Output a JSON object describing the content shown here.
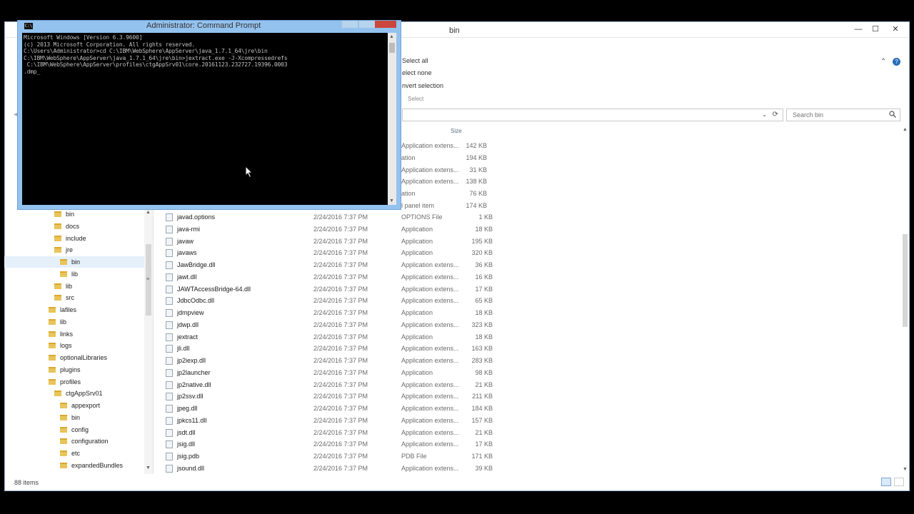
{
  "explorer": {
    "title": "bin",
    "controls": {
      "minimize": "—",
      "maximize": "☐",
      "close": "✕"
    },
    "ribbon": {
      "select_all": "Select all",
      "select_none": "elect none",
      "invert_selection": "nvert selection",
      "group_label": "Select"
    },
    "search_placeholder": "Search bin",
    "columns": {
      "size": "Size"
    },
    "nav_items": [
      {
        "label": "bin",
        "selected": false
      },
      {
        "label": "docs",
        "selected": false
      },
      {
        "label": "include",
        "selected": false
      },
      {
        "label": "jre",
        "selected": false
      },
      {
        "label": "bin",
        "selected": true
      },
      {
        "label": "lib",
        "selected": false
      },
      {
        "label": "lib",
        "selected": false
      },
      {
        "label": "src",
        "selected": false
      },
      {
        "label": "lafiles",
        "selected": false
      },
      {
        "label": "lib",
        "selected": false
      },
      {
        "label": "links",
        "selected": false
      },
      {
        "label": "logs",
        "selected": false
      },
      {
        "label": "optionalLibraries",
        "selected": false
      },
      {
        "label": "plugins",
        "selected": false
      },
      {
        "label": "profiles",
        "selected": false
      },
      {
        "label": "ctgAppSrv01",
        "selected": false
      },
      {
        "label": "appexport",
        "selected": false
      },
      {
        "label": "bin",
        "selected": false
      },
      {
        "label": "config",
        "selected": false
      },
      {
        "label": "configuration",
        "selected": false
      },
      {
        "label": "etc",
        "selected": false
      },
      {
        "label": "expandedBundles",
        "selected": false
      }
    ],
    "partial_rows": [
      {
        "type": "Application extens...",
        "size": "142 KB"
      },
      {
        "type": "ation",
        "size": "194 KB"
      },
      {
        "type": "Application extens...",
        "size": "31 KB"
      },
      {
        "type": "Application extens...",
        "size": "138 KB"
      },
      {
        "type": "ation",
        "size": "76 KB"
      },
      {
        "type": "l panel item",
        "size": "174 KB"
      }
    ],
    "files": [
      {
        "name": "javad.options",
        "date": "2/24/2016 7:37 PM",
        "type": "OPTIONS File",
        "size": "1 KB"
      },
      {
        "name": "java-rmi",
        "date": "2/24/2016 7:37 PM",
        "type": "Application",
        "size": "18 KB"
      },
      {
        "name": "javaw",
        "date": "2/24/2016 7:37 PM",
        "type": "Application",
        "size": "195 KB"
      },
      {
        "name": "javaws",
        "date": "2/24/2016 7:37 PM",
        "type": "Application",
        "size": "320 KB"
      },
      {
        "name": "JawBridge.dll",
        "date": "2/24/2016 7:37 PM",
        "type": "Application extens...",
        "size": "36 KB"
      },
      {
        "name": "jawt.dll",
        "date": "2/24/2016 7:37 PM",
        "type": "Application extens...",
        "size": "16 KB"
      },
      {
        "name": "JAWTAccessBridge-64.dll",
        "date": "2/24/2016 7:37 PM",
        "type": "Application extens...",
        "size": "17 KB"
      },
      {
        "name": "JdbcOdbc.dll",
        "date": "2/24/2016 7:37 PM",
        "type": "Application extens...",
        "size": "65 KB"
      },
      {
        "name": "jdmpview",
        "date": "2/24/2016 7:37 PM",
        "type": "Application",
        "size": "18 KB"
      },
      {
        "name": "jdwp.dll",
        "date": "2/24/2016 7:37 PM",
        "type": "Application extens...",
        "size": "323 KB"
      },
      {
        "name": "jextract",
        "date": "2/24/2016 7:37 PM",
        "type": "Application",
        "size": "18 KB"
      },
      {
        "name": "jli.dll",
        "date": "2/24/2016 7:37 PM",
        "type": "Application extens...",
        "size": "163 KB"
      },
      {
        "name": "jp2iexp.dll",
        "date": "2/24/2016 7:37 PM",
        "type": "Application extens...",
        "size": "283 KB"
      },
      {
        "name": "jp2launcher",
        "date": "2/24/2016 7:37 PM",
        "type": "Application",
        "size": "98 KB"
      },
      {
        "name": "jp2native.dll",
        "date": "2/24/2016 7:37 PM",
        "type": "Application extens...",
        "size": "21 KB"
      },
      {
        "name": "jp2ssv.dll",
        "date": "2/24/2016 7:37 PM",
        "type": "Application extens...",
        "size": "211 KB"
      },
      {
        "name": "jpeg.dll",
        "date": "2/24/2016 7:37 PM",
        "type": "Application extens...",
        "size": "184 KB"
      },
      {
        "name": "jpkcs11.dll",
        "date": "2/24/2016 7:37 PM",
        "type": "Application extens...",
        "size": "157 KB"
      },
      {
        "name": "jsdt.dll",
        "date": "2/24/2016 7:37 PM",
        "type": "Application extens...",
        "size": "21 KB"
      },
      {
        "name": "jsig.dll",
        "date": "2/24/2016 7:37 PM",
        "type": "Application extens...",
        "size": "17 KB"
      },
      {
        "name": "jsig.pdb",
        "date": "2/24/2016 7:37 PM",
        "type": "PDB File",
        "size": "171 KB"
      },
      {
        "name": "jsound.dll",
        "date": "2/24/2016 7:37 PM",
        "type": "Application extens...",
        "size": "39 KB"
      }
    ],
    "status_text": "88 items"
  },
  "cmd": {
    "title": "Administrator: Command Prompt",
    "lines": [
      "Microsoft Windows [Version 6.3.9600]",
      "(c) 2013 Microsoft Corporation. All rights reserved.",
      "",
      "C:\\Users\\Administrator>cd C:\\IBM\\WebSphere\\AppServer\\java_1.7.1_64\\jre\\bin",
      "",
      "C:\\IBM\\WebSphere\\AppServer\\java_1.7.1_64\\jre\\bin>jextract.exe -J-Xcompressedrefs",
      " C:\\IBM\\WebSphere\\AppServer\\profiles\\ctgAppSrv01\\core.20161123.232727.19396.0003",
      ".dmp_"
    ]
  },
  "icons": {
    "search": "magnifier-icon",
    "refresh": "refresh-icon",
    "dropdown": "chevron-down-icon",
    "help": "help-icon"
  },
  "colors": {
    "cmd_frame": "#94c2ee",
    "cmd_close": "#c9473d",
    "folder": "#e8c45a",
    "selection": "#e5f0fb"
  }
}
